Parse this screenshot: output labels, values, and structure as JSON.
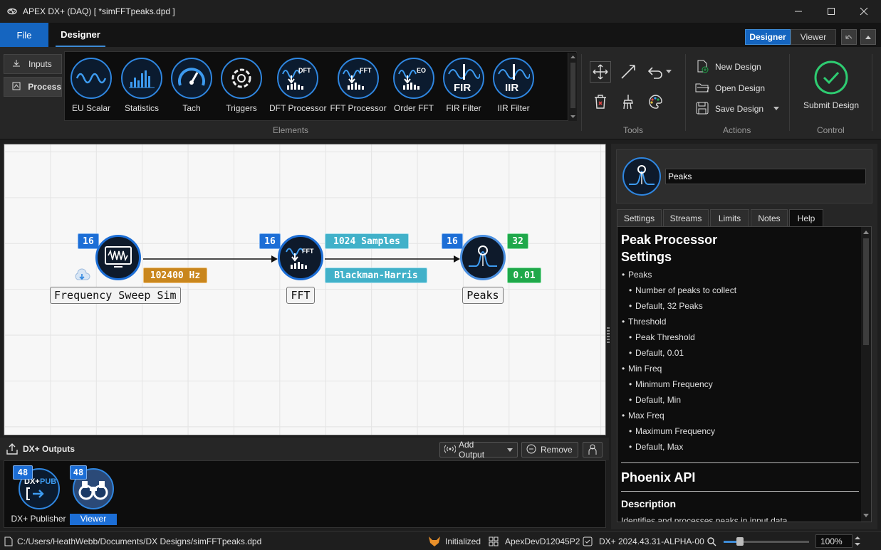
{
  "window": {
    "title": "APEX DX+ (DAQ) [ *simFFTpeaks.dpd ]"
  },
  "tabs": {
    "file": "File",
    "designer": "Designer"
  },
  "view_switch": {
    "designer": "Designer",
    "viewer": "Viewer"
  },
  "side_buttons": {
    "inputs": "Inputs",
    "process": "Process"
  },
  "elements": {
    "group_label": "Elements",
    "items": [
      "EU Scalar",
      "Statistics",
      "Tach",
      "Triggers",
      "DFT Processor",
      "FFT Processor",
      "Order FFT",
      "FIR Filter",
      "IIR Filter"
    ]
  },
  "tools": {
    "group_label": "Tools"
  },
  "actions": {
    "group_label": "Actions",
    "new": "New Design",
    "open": "Open Design",
    "save": "Save Design"
  },
  "control": {
    "group_label": "Control",
    "submit": "Submit Design"
  },
  "canvas": {
    "nodes": {
      "sweep": {
        "label": "Frequency Sweep Sim",
        "in_count": "16",
        "param": "102400 Hz"
      },
      "fft": {
        "label": "FFT",
        "in_count": "16",
        "samples": "1024 Samples",
        "window": "Blackman-Harris"
      },
      "peaks": {
        "label": "Peaks",
        "in_count": "16",
        "count": "32",
        "threshold": "0.01"
      }
    }
  },
  "outputs": {
    "title": "DX+ Outputs",
    "add_output": "Add Output",
    "remove": "Remove",
    "items": [
      {
        "label": "DX+ Publisher",
        "count": "48",
        "icon_text": "DX+PUB"
      },
      {
        "label": "Viewer",
        "count": "48"
      }
    ]
  },
  "properties": {
    "name_value": "Peaks",
    "tabs": [
      "Settings",
      "Streams",
      "Limits",
      "Notes",
      "Help"
    ],
    "help": {
      "title1": "Peak Processor",
      "title2": "Settings",
      "lines": [
        {
          "level": 1,
          "text": "Peaks"
        },
        {
          "level": 2,
          "text": "Number of peaks to collect"
        },
        {
          "level": 2,
          "text": "Default, 32 Peaks"
        },
        {
          "level": 1,
          "text": "Threshold"
        },
        {
          "level": 2,
          "text": "Peak Threshold"
        },
        {
          "level": 2,
          "text": "Default, 0.01"
        },
        {
          "level": 1,
          "text": "Min Freq"
        },
        {
          "level": 2,
          "text": "Minimum Frequency"
        },
        {
          "level": 2,
          "text": "Default, Min"
        },
        {
          "level": 1,
          "text": "Max Freq"
        },
        {
          "level": 2,
          "text": "Maximum Frequency"
        },
        {
          "level": 2,
          "text": "Default, Max"
        }
      ],
      "api_title": "Phoenix API",
      "desc_title": "Description",
      "desc_text": "Identifies and processes peaks in input data."
    }
  },
  "status": {
    "path": "C:/Users/HeathWebb/Documents/DX Designs/simFFTpeaks.dpd",
    "state": "Initialized",
    "device": "ApexDevD12045P2",
    "version": "DX+ 2024.43.31-ALPHA-00",
    "zoom": "100%"
  },
  "colors": {
    "accent": "#1c6ed6",
    "green": "#1fa84a",
    "cyan": "#41b1c9",
    "orange": "#c9861d"
  }
}
